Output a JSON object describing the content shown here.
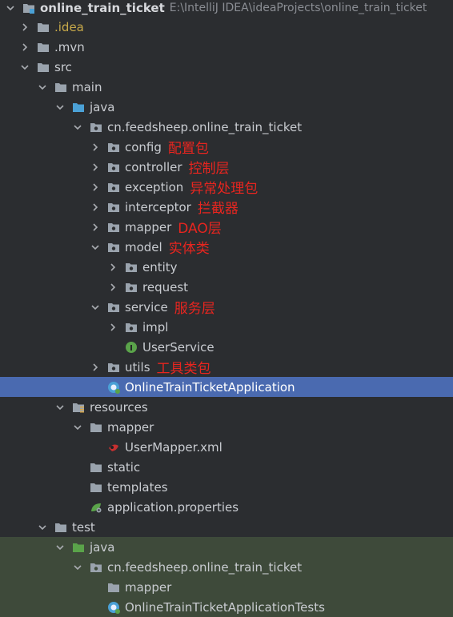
{
  "project": {
    "name": "online_train_ticket",
    "path": "E:\\IntelliJ IDEA\\ideaProjects\\online_train_ticket"
  },
  "colors": {
    "background": "#2b2d30",
    "selection": "#4a6ab0",
    "annotation": "#e8251f",
    "folder": "#9aa3ad",
    "source_folder": "#4ba1d6",
    "test_folder": "#5aa34a"
  },
  "tree": {
    "idea": ".idea",
    "mvn": ".mvn",
    "src": "src",
    "main": "main",
    "java": "java",
    "package": "cn.feedsheep.online_train_ticket",
    "config": "config",
    "config_note": "配置包",
    "controller": "controller",
    "controller_note": "控制层",
    "exception": "exception",
    "exception_note": "异常处理包",
    "interceptor": "interceptor",
    "interceptor_note": "拦截器",
    "mapper": "mapper",
    "mapper_note": "DAO层",
    "model": "model",
    "model_note": "实体类",
    "entity": "entity",
    "request": "request",
    "service": "service",
    "service_note": "服务层",
    "impl": "impl",
    "user_service": "UserService",
    "utils": "utils",
    "utils_note": "工具类包",
    "app_class": "OnlineTrainTicketApplication",
    "resources": "resources",
    "res_mapper": "mapper",
    "user_mapper_xml": "UserMapper.xml",
    "static": "static",
    "templates": "templates",
    "app_props": "application.properties",
    "test": "test",
    "test_java": "java",
    "test_package": "cn.feedsheep.online_train_ticket",
    "test_mapper": "mapper",
    "test_class": "OnlineTrainTicketApplicationTests"
  }
}
